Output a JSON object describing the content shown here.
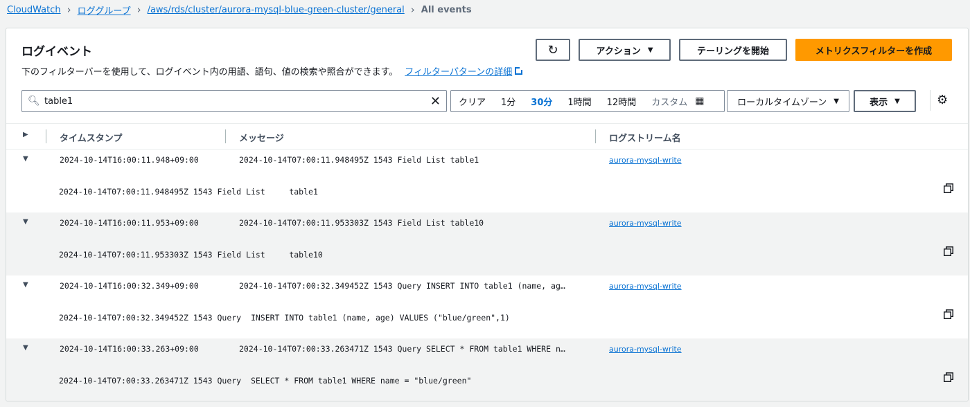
{
  "breadcrumb": {
    "items": [
      "CloudWatch",
      "ロググループ",
      "/aws/rds/cluster/aurora-mysql-blue-green-cluster/general"
    ],
    "current": "All events"
  },
  "header": {
    "title": "ログイベント",
    "description": "下のフィルターバーを使用して、ログイベント内の用語、語句、値の検索や照合ができます。",
    "link_label": "フィルターパターンの詳細"
  },
  "buttons": {
    "refresh": "C",
    "actions": "アクション",
    "tail": "テーリングを開始",
    "create_metric": "メトリクスフィルターを作成"
  },
  "search": {
    "value": "table1"
  },
  "time_range": {
    "clear": "クリア",
    "options": [
      "1分",
      "30分",
      "1時間",
      "12時間"
    ],
    "selected": "30分",
    "custom": "カスタム"
  },
  "timezone": "ローカルタイムゾーン",
  "display": "表示",
  "columns": {
    "timestamp": "タイムスタンプ",
    "message": "メッセージ",
    "stream": "ログストリーム名"
  },
  "rows": [
    {
      "timestamp": "2024-10-14T16:00:11.948+09:00",
      "message": "2024-10-14T07:00:11.948495Z 1543 Field List table1",
      "stream": "aurora-mysql-write",
      "detail": "2024-10-14T07:00:11.948495Z 1543 Field List     table1"
    },
    {
      "timestamp": "2024-10-14T16:00:11.953+09:00",
      "message": "2024-10-14T07:00:11.953303Z 1543 Field List table10",
      "stream": "aurora-mysql-write",
      "detail": "2024-10-14T07:00:11.953303Z 1543 Field List     table10"
    },
    {
      "timestamp": "2024-10-14T16:00:32.349+09:00",
      "message": "2024-10-14T07:00:32.349452Z 1543 Query INSERT INTO table1 (name, ag…",
      "stream": "aurora-mysql-write",
      "detail": "2024-10-14T07:00:32.349452Z 1543 Query  INSERT INTO table1 (name, age) VALUES (\"blue/green\",1)"
    },
    {
      "timestamp": "2024-10-14T16:00:33.263+09:00",
      "message": "2024-10-14T07:00:33.263471Z 1543 Query SELECT * FROM table1 WHERE n…",
      "stream": "aurora-mysql-write",
      "detail": "2024-10-14T07:00:33.263471Z 1543 Query  SELECT * FROM table1 WHERE name = \"blue/green\""
    }
  ],
  "colors": {
    "link": "#0972d3",
    "primary": "#ff9900",
    "alt_row": "#f2f3f3"
  }
}
